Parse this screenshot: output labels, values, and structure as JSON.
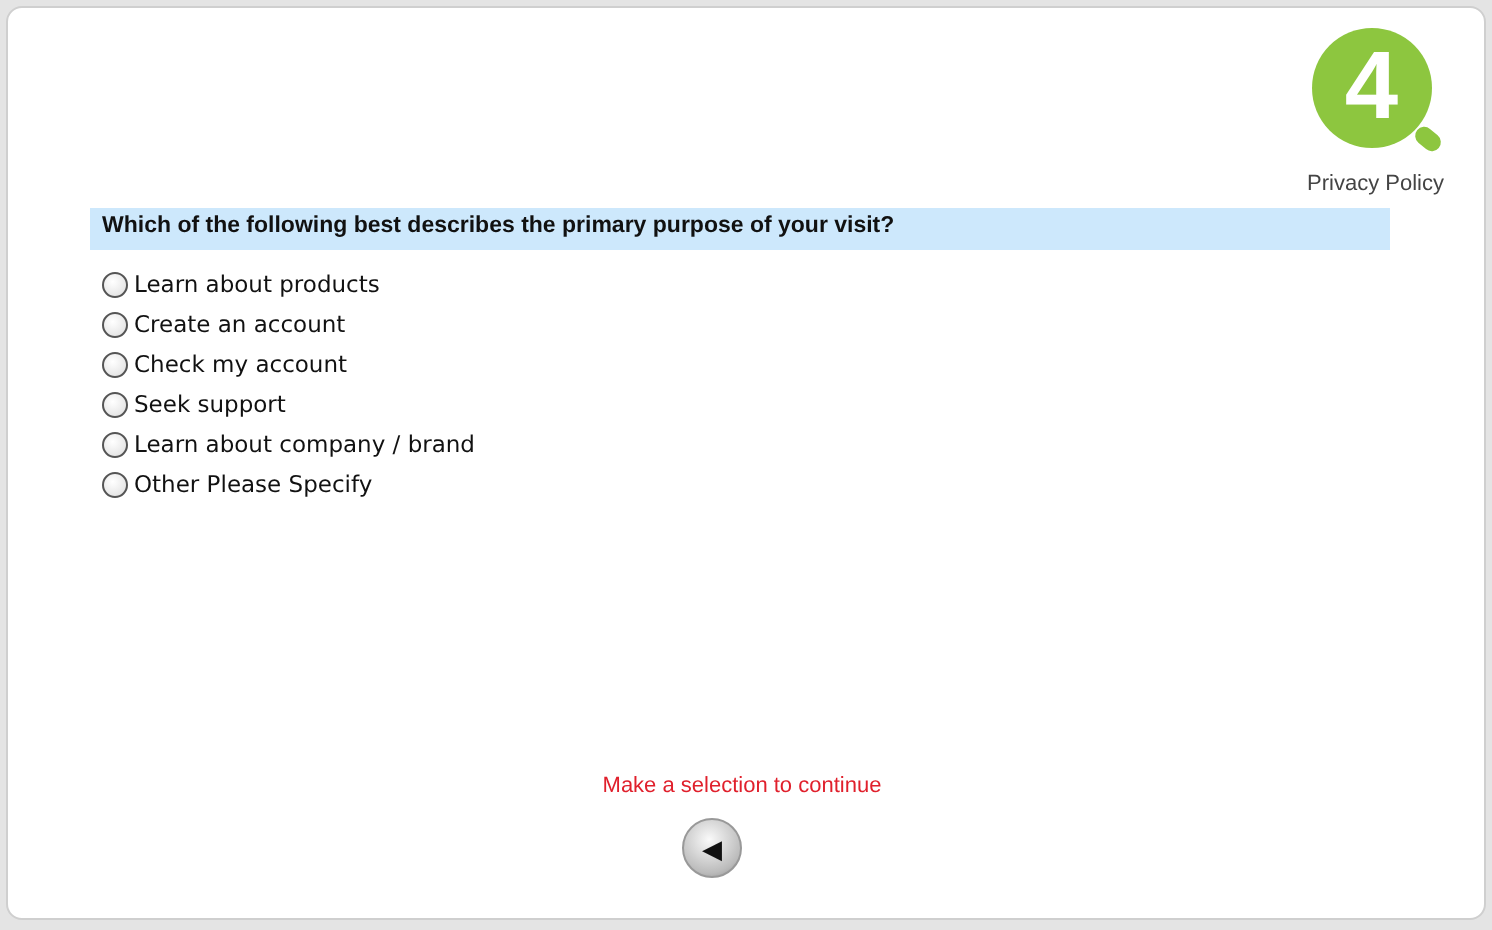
{
  "logo": {
    "text": "4"
  },
  "privacy_link": "Privacy Policy",
  "question": "Which of the following best describes the primary purpose of your visit?",
  "options": [
    {
      "label": "Learn about products",
      "selected": false
    },
    {
      "label": "Create an account",
      "selected": false
    },
    {
      "label": "Check my account",
      "selected": false
    },
    {
      "label": "Seek support",
      "selected": false
    },
    {
      "label": "Learn about company / brand",
      "selected": false
    },
    {
      "label": "Other Please Specify",
      "selected": false
    }
  ],
  "message": "Make a selection to continue",
  "back_button": {
    "text": "◀"
  }
}
